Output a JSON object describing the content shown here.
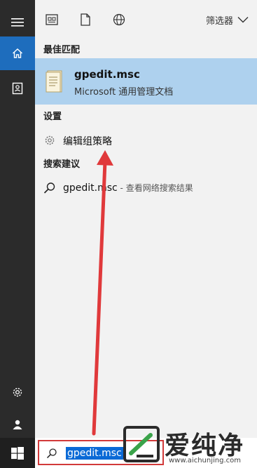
{
  "rail": {
    "icons": [
      "hamburger-menu-icon",
      "home-icon",
      "document-icon",
      "settings-gear-icon",
      "user-icon",
      "windows-logo-icon"
    ],
    "accent": "#1e6dbd"
  },
  "toolbar": {
    "icons": [
      "apps-icon",
      "documents-icon",
      "web-globe-icon"
    ],
    "filter_label": "筛选器"
  },
  "results": {
    "best_match_header": "最佳匹配",
    "best_match": {
      "title": "gpedit.msc",
      "subtitle": "Microsoft 通用管理文档",
      "highlight": "#aed1ee"
    },
    "settings_header": "设置",
    "settings_item": "编辑组策略",
    "suggestions_header": "搜索建议",
    "suggestion": {
      "query": "gpedit.msc",
      "suffix": " - 查看网络搜索结果"
    }
  },
  "search": {
    "value": "gpedit.msc",
    "highlight_color": "#0a6ad6",
    "border_color": "#d23a3a"
  },
  "watermark": {
    "text": "爱纯净",
    "url": "www.aichunjing.com"
  },
  "annotation": {
    "arrow_color": "#e0393b"
  }
}
